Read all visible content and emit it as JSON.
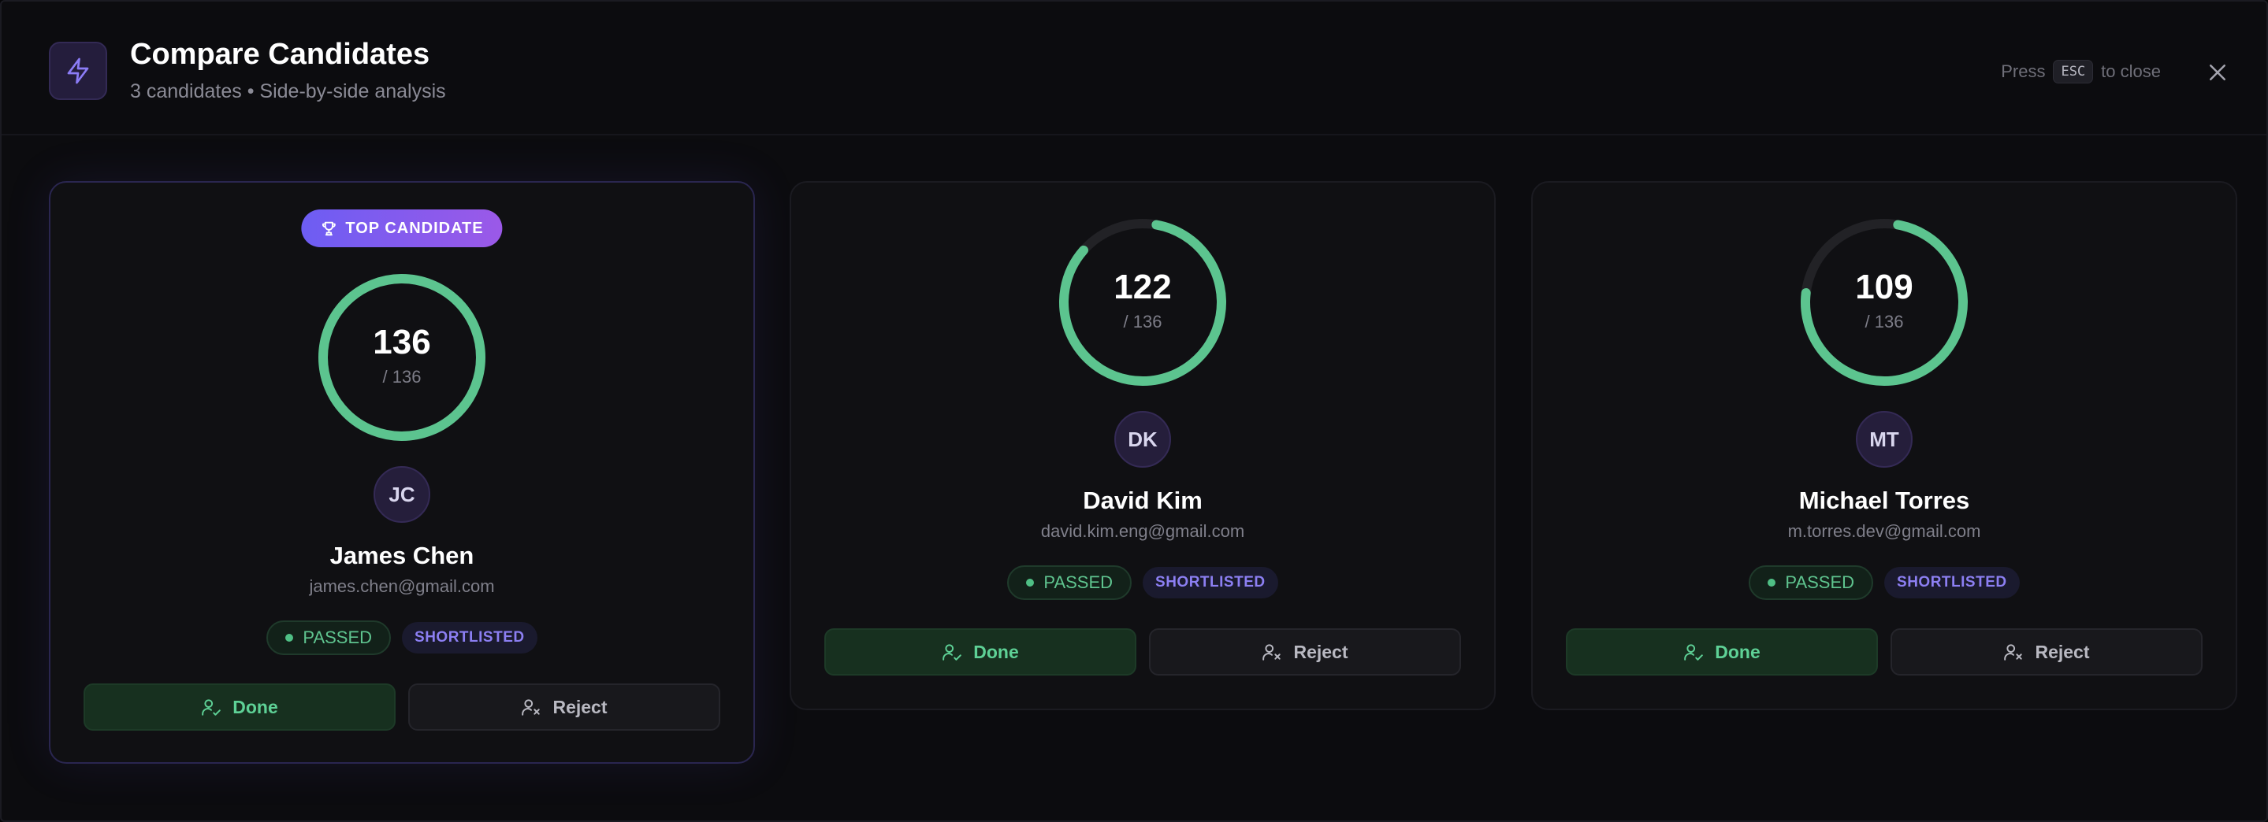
{
  "header": {
    "title": "Compare Candidates",
    "subtitle": "3 candidates • Side-by-side analysis",
    "esc_prefix": "Press",
    "esc_key": "ESC",
    "esc_suffix": "to close"
  },
  "colors": {
    "accent": "#7c5cf2",
    "score_ring": "#5cc48f",
    "ring_track": "#222226",
    "passed": "#5fc48f",
    "shortlisted": "#8c7ff2"
  },
  "candidates": [
    {
      "is_top": true,
      "top_label": "TOP CANDIDATE",
      "score": "136",
      "score_max": "/ 136",
      "score_fraction": 1.0,
      "initials": "JC",
      "name": "James Chen",
      "email": "james.chen@gmail.com",
      "status": "PASSED",
      "tag": "SHORTLISTED",
      "done_label": "Done",
      "reject_label": "Reject"
    },
    {
      "is_top": false,
      "score": "122",
      "score_max": "/ 136",
      "score_fraction": 0.897,
      "initials": "DK",
      "name": "David Kim",
      "email": "david.kim.eng@gmail.com",
      "status": "PASSED",
      "tag": "SHORTLISTED",
      "done_label": "Done",
      "reject_label": "Reject"
    },
    {
      "is_top": false,
      "score": "109",
      "score_max": "/ 136",
      "score_fraction": 0.801,
      "initials": "MT",
      "name": "Michael Torres",
      "email": "m.torres.dev@gmail.com",
      "status": "PASSED",
      "tag": "SHORTLISTED",
      "done_label": "Done",
      "reject_label": "Reject"
    }
  ]
}
